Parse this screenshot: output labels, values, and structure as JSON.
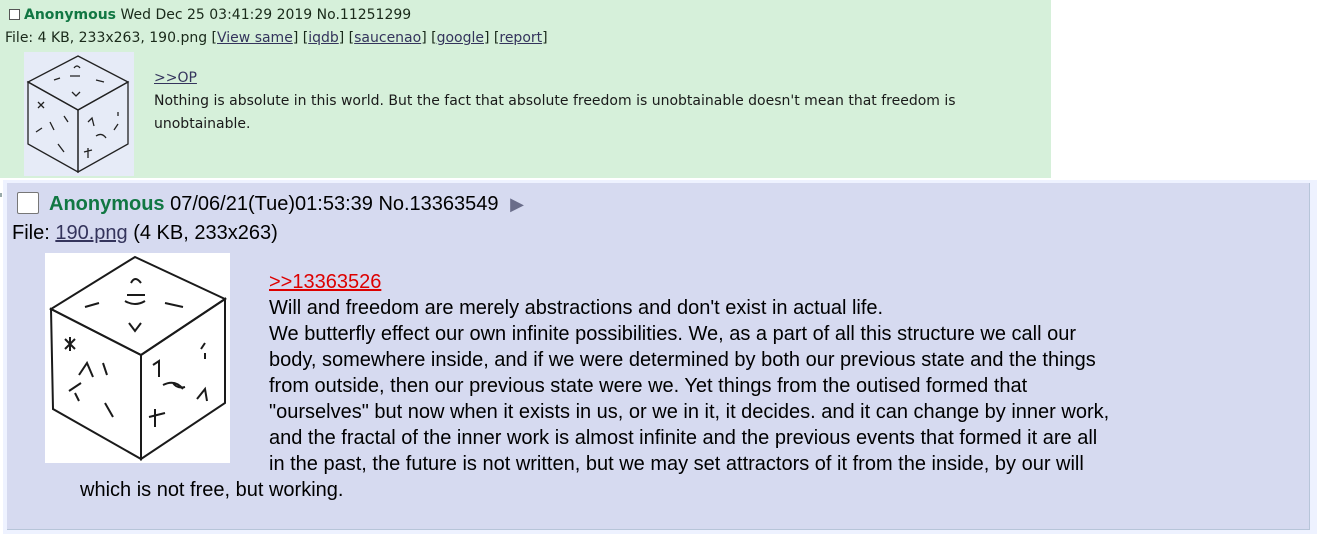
{
  "post1": {
    "name": "Anonymous",
    "datetime": "Wed Dec 25 03:41:29 2019",
    "post_no": "No.11251299",
    "file_prefix": "File: 4 KB, 233x263, 190.png",
    "links": [
      "View same",
      "iqdb",
      "saucenao",
      "google",
      "report"
    ],
    "quote": ">>OP",
    "body": "Nothing is absolute in this world. But the fact that absolute freedom is unobtainable doesn't mean that freedom is unobtainable.",
    "thumb_icon": "cube-sketch-thumbnail"
  },
  "post2": {
    "name": "Anonymous",
    "datetime": "07/06/21(Tue)01:53:39",
    "post_no": "No.13363549",
    "menu_glyph": "▶",
    "file_label": "File: ",
    "file_name": "190.png",
    "file_meta": " (4 KB, 233x263)",
    "quote": ">>13363526",
    "lines": [
      "Will and freedom are merely abstractions and don't exist in actual life.",
      "We butterfly effect our own infinite possibilities. We, as a part of all this structure we call our",
      "body, somewhere inside, and if we were determined by both our previous state and the things",
      "from outside, then our previous state were we. Yet things from the outised formed that",
      "\"ourselves\" but now when it exists in us, or we in it, it decides. and it can change by inner work,",
      "and the fractal of the inner work is almost infinite and the previous events that formed it are all",
      "in the past, the future is not written, but we may set attractors of it from the inside, by our will",
      "which is not free, but working."
    ],
    "thumb_icon": "cube-sketch-thumbnail"
  },
  "colors": {
    "post1_bg": "#d6f0da",
    "post2_bg": "#d6daf0",
    "name_green": "#117743",
    "quote_red": "#dd0000",
    "link": "#34345c"
  }
}
